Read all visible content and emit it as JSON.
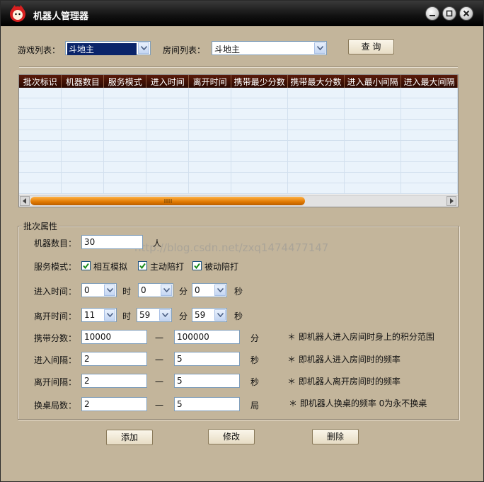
{
  "window": {
    "title": "机器人管理器"
  },
  "top": {
    "game_list_label": "游戏列表：",
    "game_list_value": "斗地主",
    "room_list_label": "房间列表：",
    "room_list_value": "斗地主",
    "query_button": "查 询"
  },
  "table": {
    "headers": [
      "批次标识",
      "机器数目",
      "服务模式",
      "进入时间",
      "离开时间",
      "携带最少分数",
      "携带最大分数",
      "进入最小间隔",
      "进入最大间隔"
    ],
    "rows": []
  },
  "batch": {
    "group_title": "批次属性",
    "robot_count_label": "机器数目：",
    "robot_count_value": "30",
    "robot_count_unit": "人",
    "service_mode_label": "服务模式：",
    "mode_mutual": "相互模拟",
    "mode_mutual_checked": true,
    "mode_active": "主动陪打",
    "mode_active_checked": true,
    "mode_passive": "被动陪打",
    "mode_passive_checked": true,
    "enter_time_label": "进入时间：",
    "enter_hour": "0",
    "enter_minute": "0",
    "enter_second": "0",
    "leave_time_label": "离开时间：",
    "leave_hour": "11",
    "leave_minute": "59",
    "leave_second": "59",
    "unit_hour": "时",
    "unit_minute": "分",
    "unit_second": "秒",
    "dash": "一",
    "carry_score_label": "携带分数：",
    "carry_score_min": "10000",
    "carry_score_max": "100000",
    "carry_score_unit": "分",
    "carry_score_note": "＊ 即机器人进入房间时身上的积分范围",
    "enter_interval_label": "进入间隔：",
    "enter_interval_min": "2",
    "enter_interval_max": "5",
    "enter_interval_unit": "秒",
    "enter_interval_note": "＊ 即机器人进入房间时的频率",
    "leave_interval_label": "离开间隔：",
    "leave_interval_min": "2",
    "leave_interval_max": "5",
    "leave_interval_unit": "秒",
    "leave_interval_note": "＊ 即机器人离开房间时的频率",
    "switch_rounds_label": "换桌局数：",
    "switch_rounds_min": "2",
    "switch_rounds_max": "5",
    "switch_rounds_unit": "局",
    "switch_rounds_note": "＊ 即机器人换桌的频率 0为永不换桌"
  },
  "actions": {
    "add": "添加",
    "modify": "修改",
    "delete": "删除"
  },
  "watermark": "http://blog.csdn.net/zxq1474477147",
  "colors": {
    "background": "#c3b59b",
    "header": "#2a0a02",
    "scroll_thumb": "#e07800"
  }
}
